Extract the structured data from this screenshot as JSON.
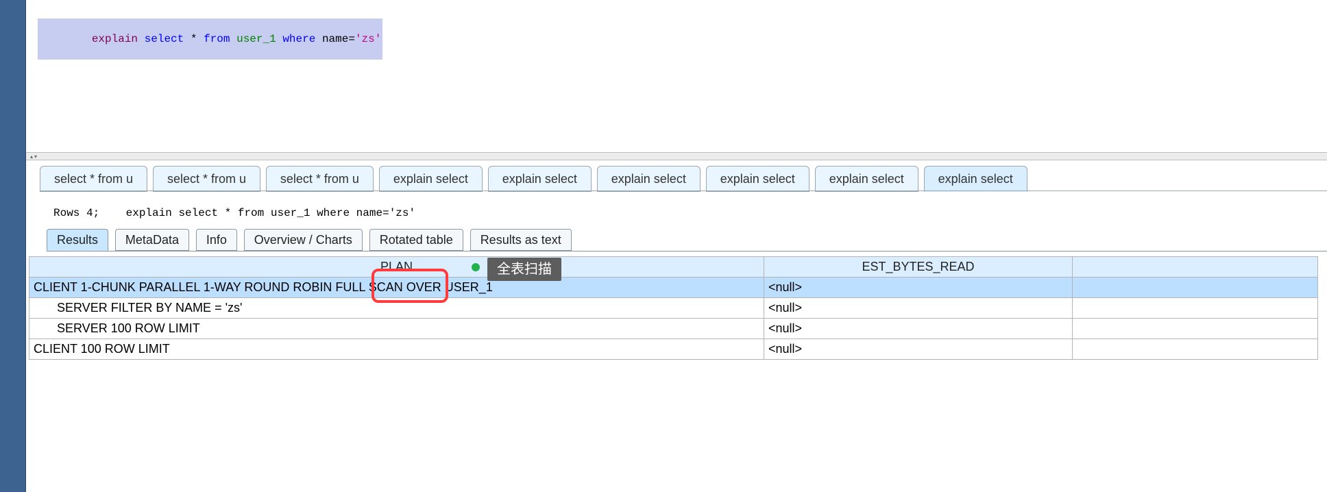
{
  "editor": {
    "tokens": [
      "explain",
      "select",
      "*",
      "from",
      "user_1",
      "where",
      "name=",
      "'zs'"
    ]
  },
  "history_tabs": [
    "select * from u",
    "select * from u",
    "select * from u",
    "explain select",
    "explain select",
    "explain select",
    "explain select",
    "explain select",
    "explain select"
  ],
  "status": {
    "rows_label": "Rows 4;",
    "query_echo": "explain select * from user_1 where name='zs'"
  },
  "result_tabs": [
    "Results",
    "MetaData",
    "Info",
    "Overview / Charts",
    "Rotated table",
    "Results as text"
  ],
  "table": {
    "columns": [
      "PLAN",
      "EST_BYTES_READ"
    ],
    "rows": [
      {
        "plan": "CLIENT 1-CHUNK PARALLEL 1-WAY ROUND ROBIN FULL SCAN OVER USER_1",
        "est": "<null>"
      },
      {
        "plan": "SERVER FILTER BY NAME = 'zs'",
        "est": "<null>"
      },
      {
        "plan": "SERVER 100 ROW LIMIT",
        "est": "<null>"
      },
      {
        "plan": "CLIENT 100 ROW LIMIT",
        "est": "<null>"
      }
    ]
  },
  "annotation": {
    "tooltip_text": "全表扫描",
    "highlighted_phrase": "FULL SCAN"
  }
}
